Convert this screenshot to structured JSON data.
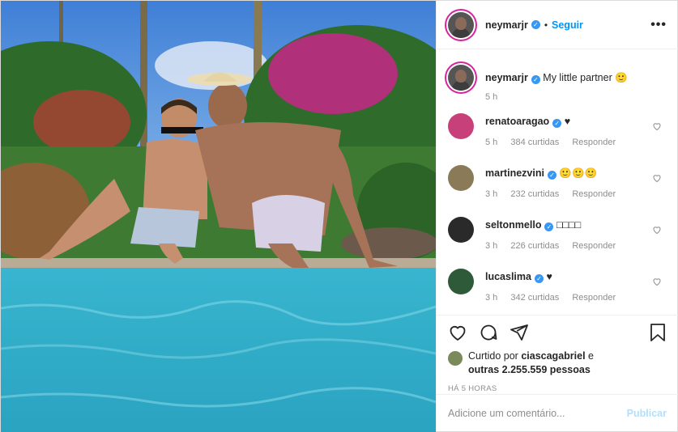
{
  "post": {
    "author": "neymarjr",
    "follow_label": "Seguir",
    "more_label": "•••",
    "dot": "•",
    "caption": {
      "author": "neymarjr",
      "text": "My little partner 🙂",
      "time": "5 h"
    }
  },
  "comments": [
    {
      "user": "renatoaragao",
      "verified": true,
      "text": "♥",
      "time": "5 h",
      "likes": "384 curtidas",
      "reply": "Responder"
    },
    {
      "user": "martinezvini",
      "verified": true,
      "text": "🙂🙂🙂",
      "time": "3 h",
      "likes": "232 curtidas",
      "reply": "Responder"
    },
    {
      "user": "seltonmello",
      "verified": true,
      "text": "□□□□",
      "time": "3 h",
      "likes": "226 curtidas",
      "reply": "Responder"
    },
    {
      "user": "lucaslima",
      "verified": true,
      "text": "♥",
      "time": "3 h",
      "likes": "342 curtidas",
      "reply": "Responder"
    }
  ],
  "likes": {
    "prefix": "Curtido por",
    "user": "ciascagabriel",
    "middle": "e",
    "others": "outras 2.255.559 pessoas"
  },
  "posted_ago": "HÁ 5 HORAS",
  "add_comment": {
    "placeholder": "Adicione um comentário...",
    "publish": "Publicar"
  },
  "colors": {
    "link_blue": "#0095f6",
    "verified_blue": "#3897f0",
    "muted": "#8e8e8e",
    "pool": "#3aa6c3"
  },
  "icons": [
    "heart-icon",
    "comment-icon",
    "share-icon",
    "bookmark-icon",
    "more-icon",
    "verified-icon"
  ]
}
